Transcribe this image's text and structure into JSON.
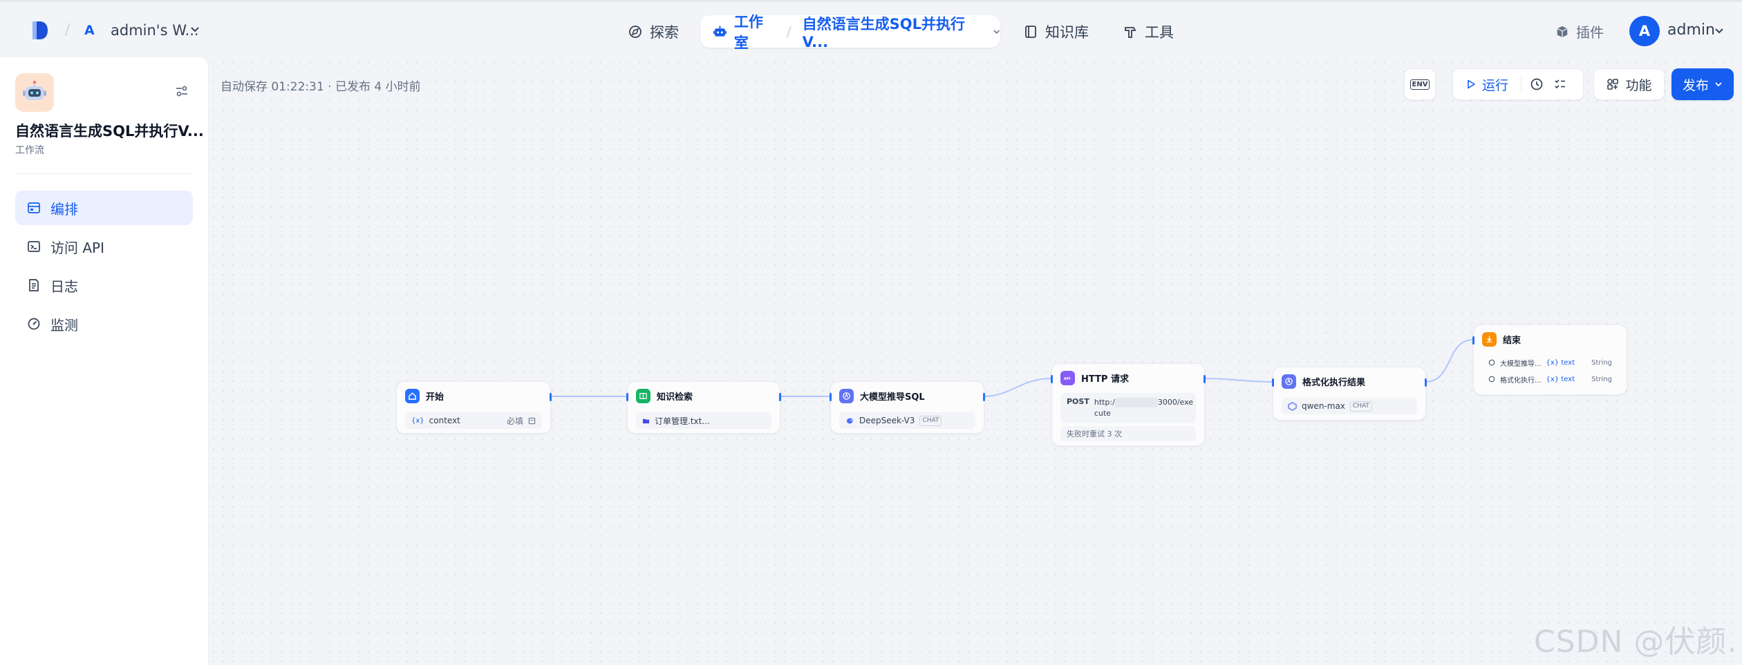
{
  "topbar": {
    "workspace": {
      "initial": "A",
      "name": "admin's W..."
    },
    "nav": {
      "explore": "探索",
      "studio": "工作室",
      "current_app": "自然语言生成SQL并执行V...",
      "knowledge": "知识库",
      "tools": "工具"
    },
    "plugins": "插件",
    "user": {
      "initial": "A",
      "name": "admin"
    }
  },
  "sidebar": {
    "app_title": "自然语言生成SQL并执行V...",
    "app_kind": "工作流",
    "menu": [
      {
        "label": "编排",
        "icon": "workflow-icon",
        "active": true
      },
      {
        "label": "访问 API",
        "icon": "terminal-icon"
      },
      {
        "label": "日志",
        "icon": "log-icon"
      },
      {
        "label": "监测",
        "icon": "gauge-icon"
      }
    ]
  },
  "toolbar": {
    "autosave": "自动保存 01:22:31 · 已发布 4 小时前",
    "env": "ENV",
    "run": "运行",
    "features": "功能",
    "publish": "发布"
  },
  "nodes": {
    "start": {
      "title": "开始",
      "var": "context",
      "required": "必填",
      "accent": "#2970ff"
    },
    "knowledge": {
      "title": "知识检索",
      "dataset": "订单管理.txt...",
      "accent": "#16b364"
    },
    "llm1": {
      "title": "大模型推导SQL",
      "model": "DeepSeek-V3",
      "mode": "CHAT",
      "accent": "#6172f3"
    },
    "http": {
      "title": "HTTP 请求",
      "method": "POST",
      "url_start": "http:/",
      "url_end": "3000/exe",
      "url_tail": "cute",
      "retry": "失败时重试 3 次",
      "accent": "#875bf7"
    },
    "llm2": {
      "title": "格式化执行结果",
      "model": "qwen-max",
      "mode": "CHAT",
      "accent": "#6172f3"
    },
    "end": {
      "title": "结束",
      "accent": "#f79009",
      "outputs": [
        {
          "source": "大模型推导...",
          "var": "text",
          "type": "String"
        },
        {
          "source": "格式化执行...",
          "var": "text",
          "type": "String"
        }
      ]
    }
  },
  "watermark": "CSDN @伏颜."
}
